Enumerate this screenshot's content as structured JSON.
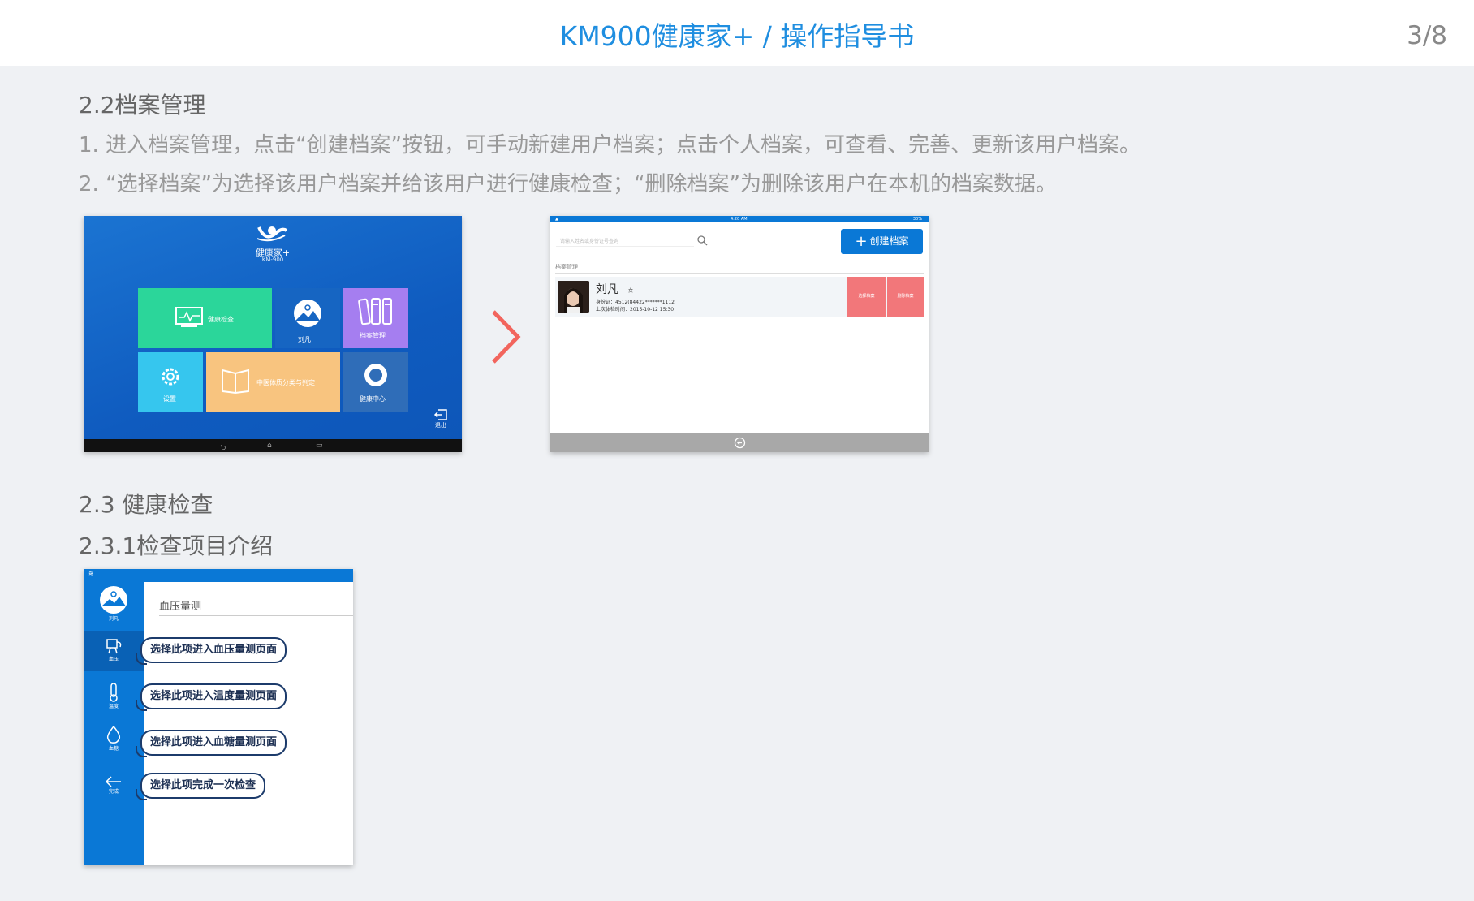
{
  "header": {
    "title": "KM900健康家+ / 操作指导书",
    "page": "3/8"
  },
  "section_22": {
    "heading": "2.2档案管理",
    "para1": "1. 进入档案管理，点击“创建档案”按钮，可手动新建用户档案；点击个人档案，可查看、完善、更新该用户档案。",
    "para2": "2. “选择档案”为选择该用户档案并给该用户进行健康检查；“删除档案”为删除该用户在本机的档案数据。"
  },
  "home_screen": {
    "brand": "健康家+",
    "model": "KM-900",
    "tiles": {
      "health_check": "健康检查",
      "user": "刘凡",
      "archive": "档案管理",
      "settings": "设置",
      "tcm": "中医体质分类与判定",
      "health_center": "健康中心"
    },
    "exit": "退出"
  },
  "archive_screen": {
    "status_time": "4:20 AM",
    "status_battery": "30%",
    "search_placeholder": "请输入姓名或身份证号查询",
    "create_button": "创建档案",
    "subtitle": "档案管理",
    "record": {
      "name": "刘凡",
      "sex": "女",
      "id_line": "身份证：4512(84422*******1112",
      "time_line": "上次体检时间：2015-10-12 15:30"
    },
    "select_button": "选择档案",
    "delete_button": "删除档案"
  },
  "section_23": {
    "heading": "2.3 健康检查",
    "subheading": "2.3.1检查项目介绍"
  },
  "checkup_screen": {
    "user": "刘凡",
    "header": "血压量测",
    "menu": {
      "bp": "血压",
      "temp": "温度",
      "sugar": "血糖",
      "done": "完成"
    },
    "callouts": {
      "bp": "选择此项进入血压量测页面",
      "temp": "选择此项进入温度量测页面",
      "sugar": "选择此项进入血糖量测页面",
      "done": "选择此项完成一次检查"
    }
  },
  "colors": {
    "title_blue": "#1f8ee0",
    "app_blue": "#0a78d6",
    "delete_red": "#f2777a",
    "chevron_red": "#f2655d"
  }
}
